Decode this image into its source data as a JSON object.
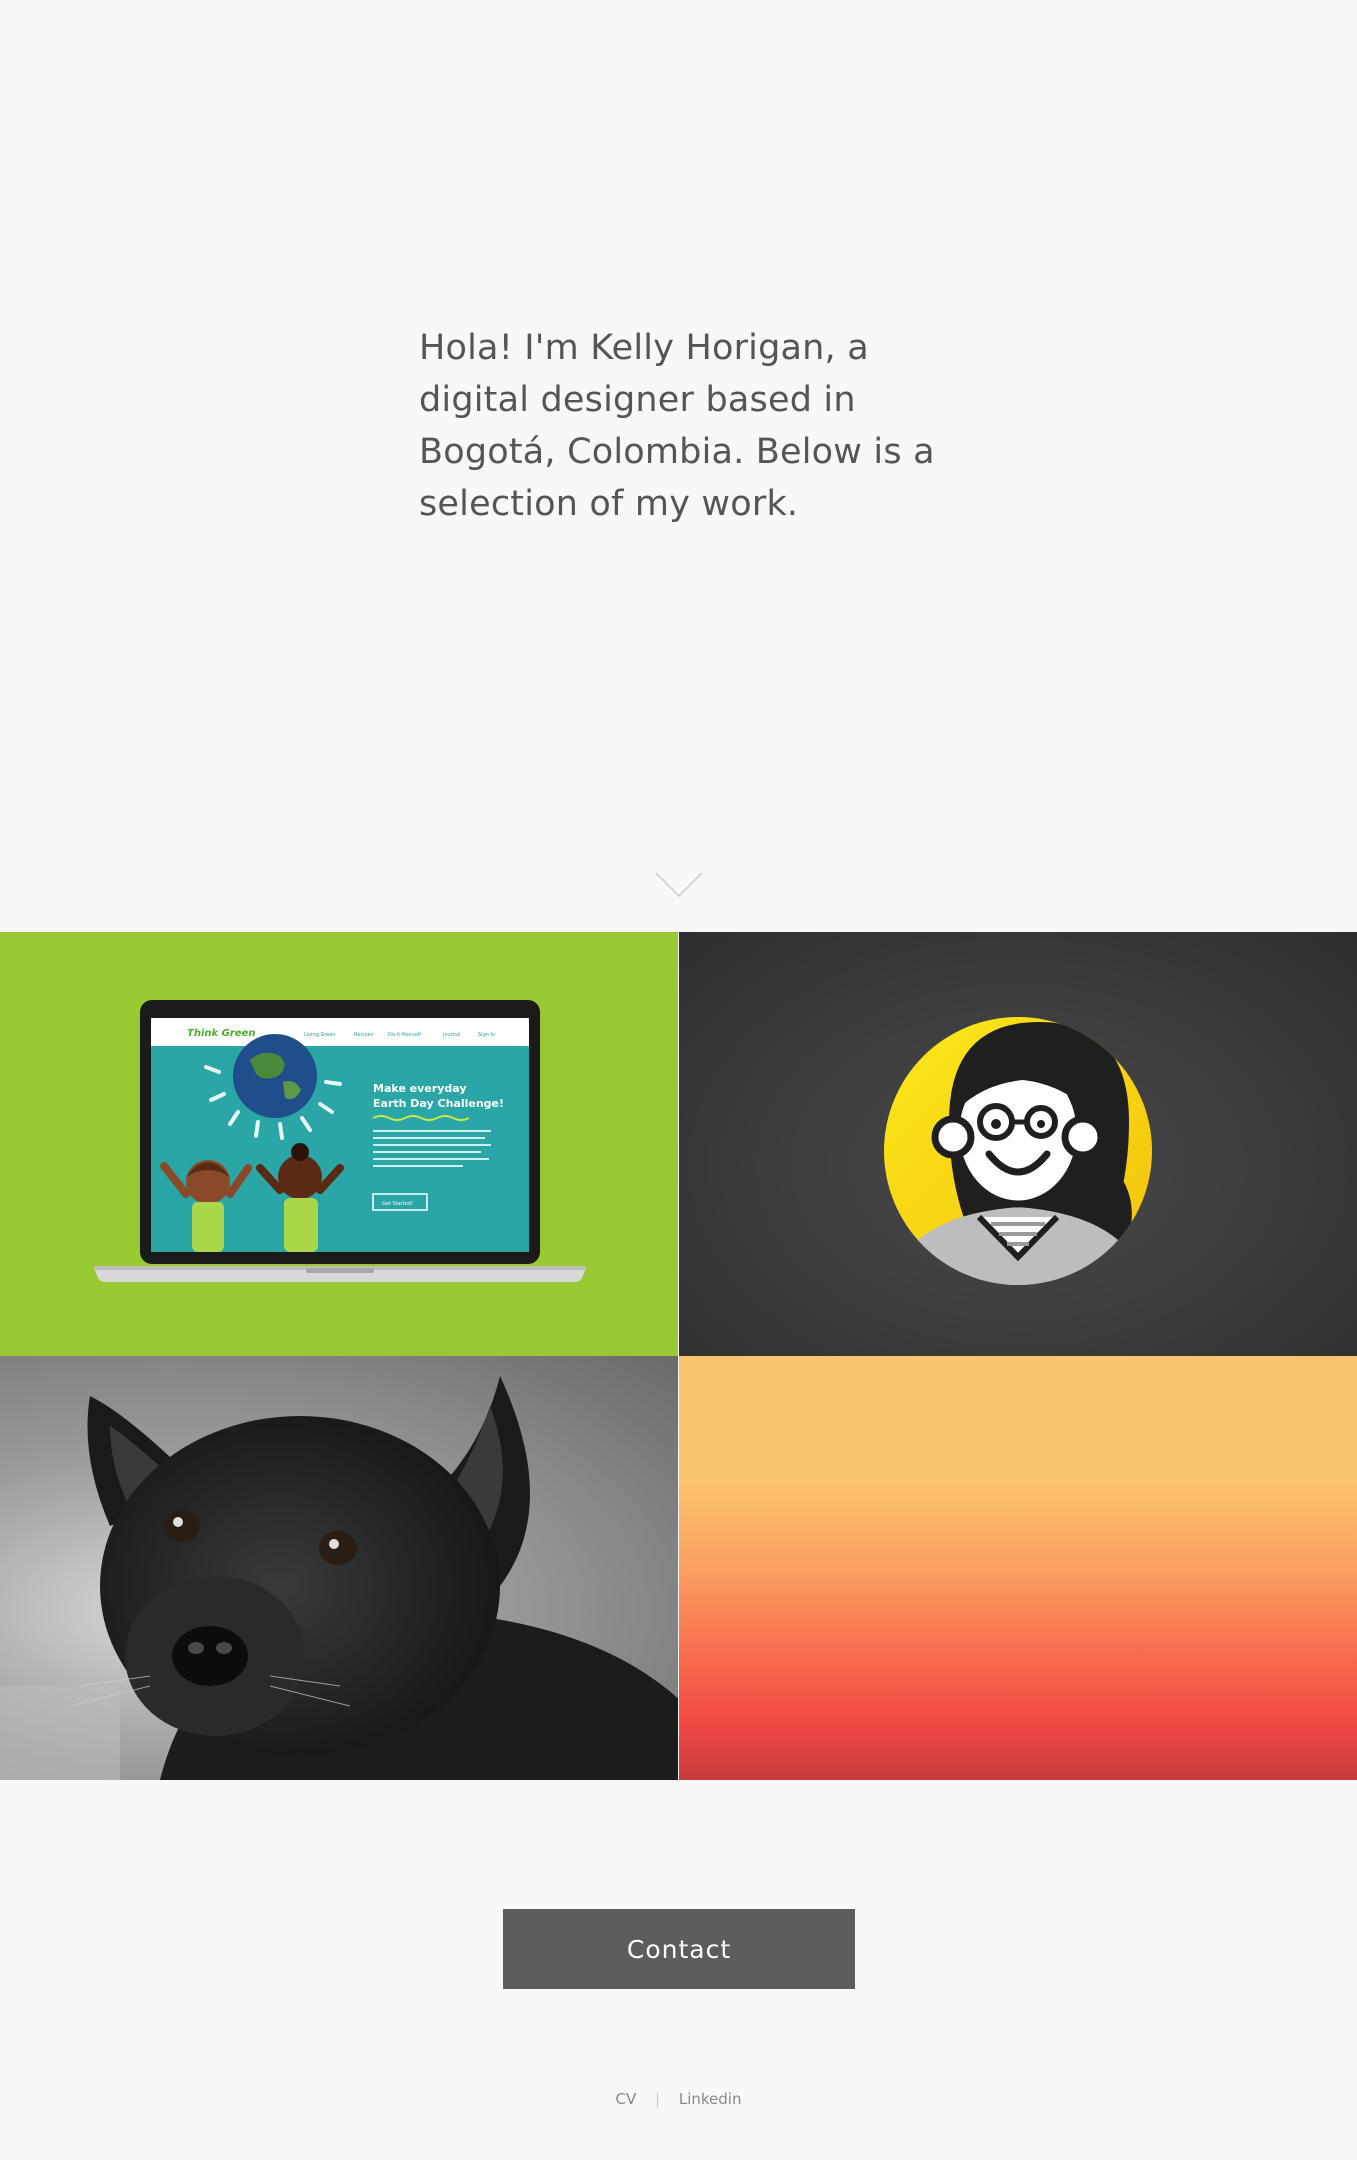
{
  "hero": {
    "intro_text": "Hola! I'm Kelly Horigan, a digital designer based in Bogotá, Colombia. Below is a selection of my work.",
    "scroll_icon": "chevron-down-icon"
  },
  "portfolio": {
    "tiles": [
      {
        "id": "think-green",
        "background": "#99c931",
        "laptop_screen": {
          "logo": "Think Green",
          "nav": [
            "Living Green",
            "Recipes",
            "Do-It-Yourself",
            "Journal",
            "Sign In"
          ],
          "headline_line1": "Make everyday",
          "headline_line2": "Earth Day Challenge!",
          "cta": "Get Started!"
        }
      },
      {
        "id": "avatar-illustration",
        "background": "#3a3a3c",
        "accent": "#f7e51a"
      },
      {
        "id": "dog-photo",
        "background": "#8a8a8a"
      },
      {
        "id": "sunset-gradient",
        "colors": [
          "#fbc56f",
          "#fba160",
          "#f86d4f",
          "#c83a3c"
        ]
      }
    ]
  },
  "contact": {
    "button_label": "Contact"
  },
  "footer": {
    "links": [
      "CV",
      "Linkedin"
    ]
  }
}
